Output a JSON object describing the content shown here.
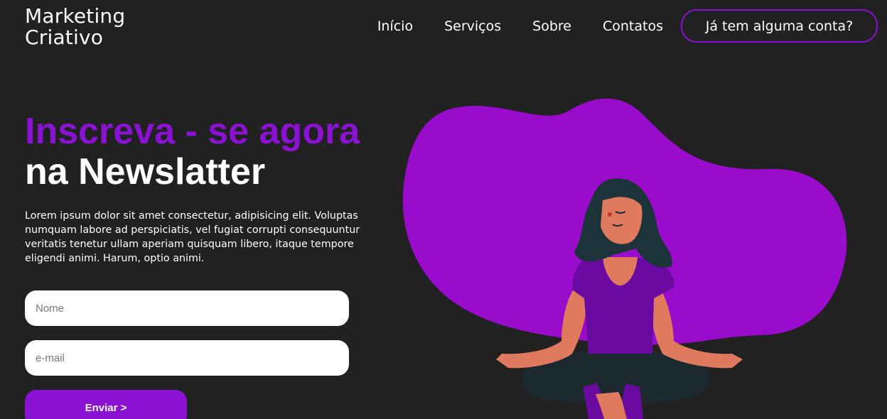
{
  "header": {
    "logo_line1": "Marketing",
    "logo_line2": "Criativo",
    "nav": {
      "home": "Início",
      "services": "Serviços",
      "about": "Sobre",
      "contacts": "Contatos"
    },
    "account_button": "Já tem alguma conta?"
  },
  "hero": {
    "title_line1": "Inscreva - se agora",
    "title_line2": "na Newslatter",
    "description": "Lorem ipsum dolor sit amet consectetur, adipisicing elit. Voluptas numquam labore ad perspiciatis, vel fugiat corrupti consequuntur veritatis tenetur ullam aperiam quisquam libero, itaque tempore eligendi animi. Harum, optio animi."
  },
  "form": {
    "name_placeholder": "Nome",
    "email_placeholder": "e-mail",
    "submit_label": "Enviar >"
  },
  "colors": {
    "background": "#222121",
    "accent": "#8a12d2",
    "blob": "#9a0ccc"
  },
  "illustration": {
    "icon": "meditating-woman-illustration"
  }
}
